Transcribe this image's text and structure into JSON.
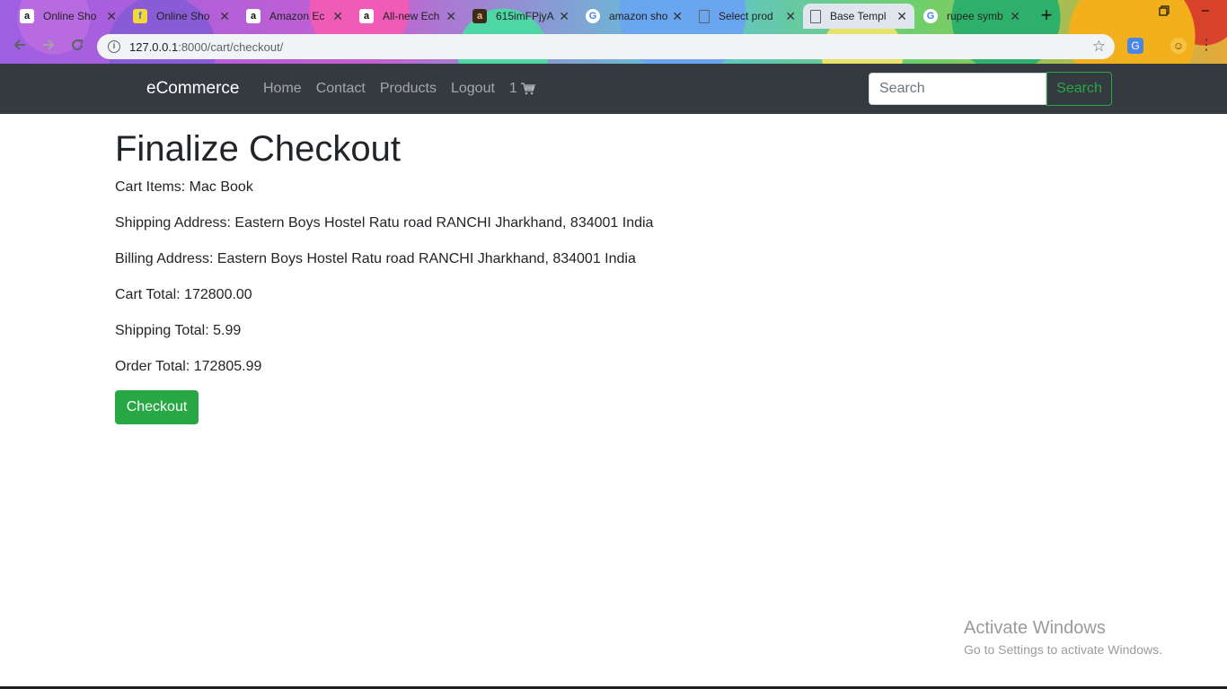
{
  "browser": {
    "tabs": [
      {
        "title": "Online Sho",
        "favicon": "amazon-icon",
        "favicon_glyph": "a"
      },
      {
        "title": "Online Sho",
        "favicon": "flipkart-icon",
        "favicon_glyph": "f"
      },
      {
        "title": "Amazon Ec",
        "favicon": "amazon-icon",
        "favicon_glyph": "a"
      },
      {
        "title": "All-new Ech",
        "favicon": "amazon-icon",
        "favicon_glyph": "a"
      },
      {
        "title": "615imFPjyA",
        "favicon": "image-icon",
        "favicon_glyph": "a"
      },
      {
        "title": "amazon sho",
        "favicon": "google-icon",
        "favicon_glyph": "G"
      },
      {
        "title": "Select prod",
        "favicon": "document-icon",
        "favicon_glyph": ""
      },
      {
        "title": "Base Templ",
        "favicon": "document-icon",
        "favicon_glyph": "",
        "active": true
      },
      {
        "title": "rupee symb",
        "favicon": "google-icon",
        "favicon_glyph": "G"
      }
    ],
    "close_glyph": "✕",
    "new_tab_glyph": "+",
    "address": "127.0.0.1:8000/cart/checkout/",
    "address_host": "127.0.0.1",
    "address_rest": ":8000/cart/checkout/"
  },
  "navbar": {
    "brand": "eCommerce",
    "links": [
      "Home",
      "Contact",
      "Products",
      "Logout"
    ],
    "cart_count": "1",
    "search_placeholder": "Search",
    "search_button": "Search",
    "bg_color": "#343a40",
    "accent": "#28a745"
  },
  "checkout": {
    "title": "Finalize Checkout",
    "cart_items": "Cart Items: Mac Book",
    "shipping_address": "Shipping Address: Eastern Boys Hostel Ratu road RANCHI Jharkhand, 834001 India",
    "billing_address": "Billing Address: Eastern Boys Hostel Ratu road RANCHI Jharkhand, 834001 India",
    "cart_total": "Cart Total: 172800.00",
    "shipping_total": "Shipping Total: 5.99",
    "order_total": "Order Total: 172805.99",
    "button": "Checkout"
  },
  "watermark": {
    "line1": "Activate Windows",
    "line2": "Go to Settings to activate Windows."
  }
}
